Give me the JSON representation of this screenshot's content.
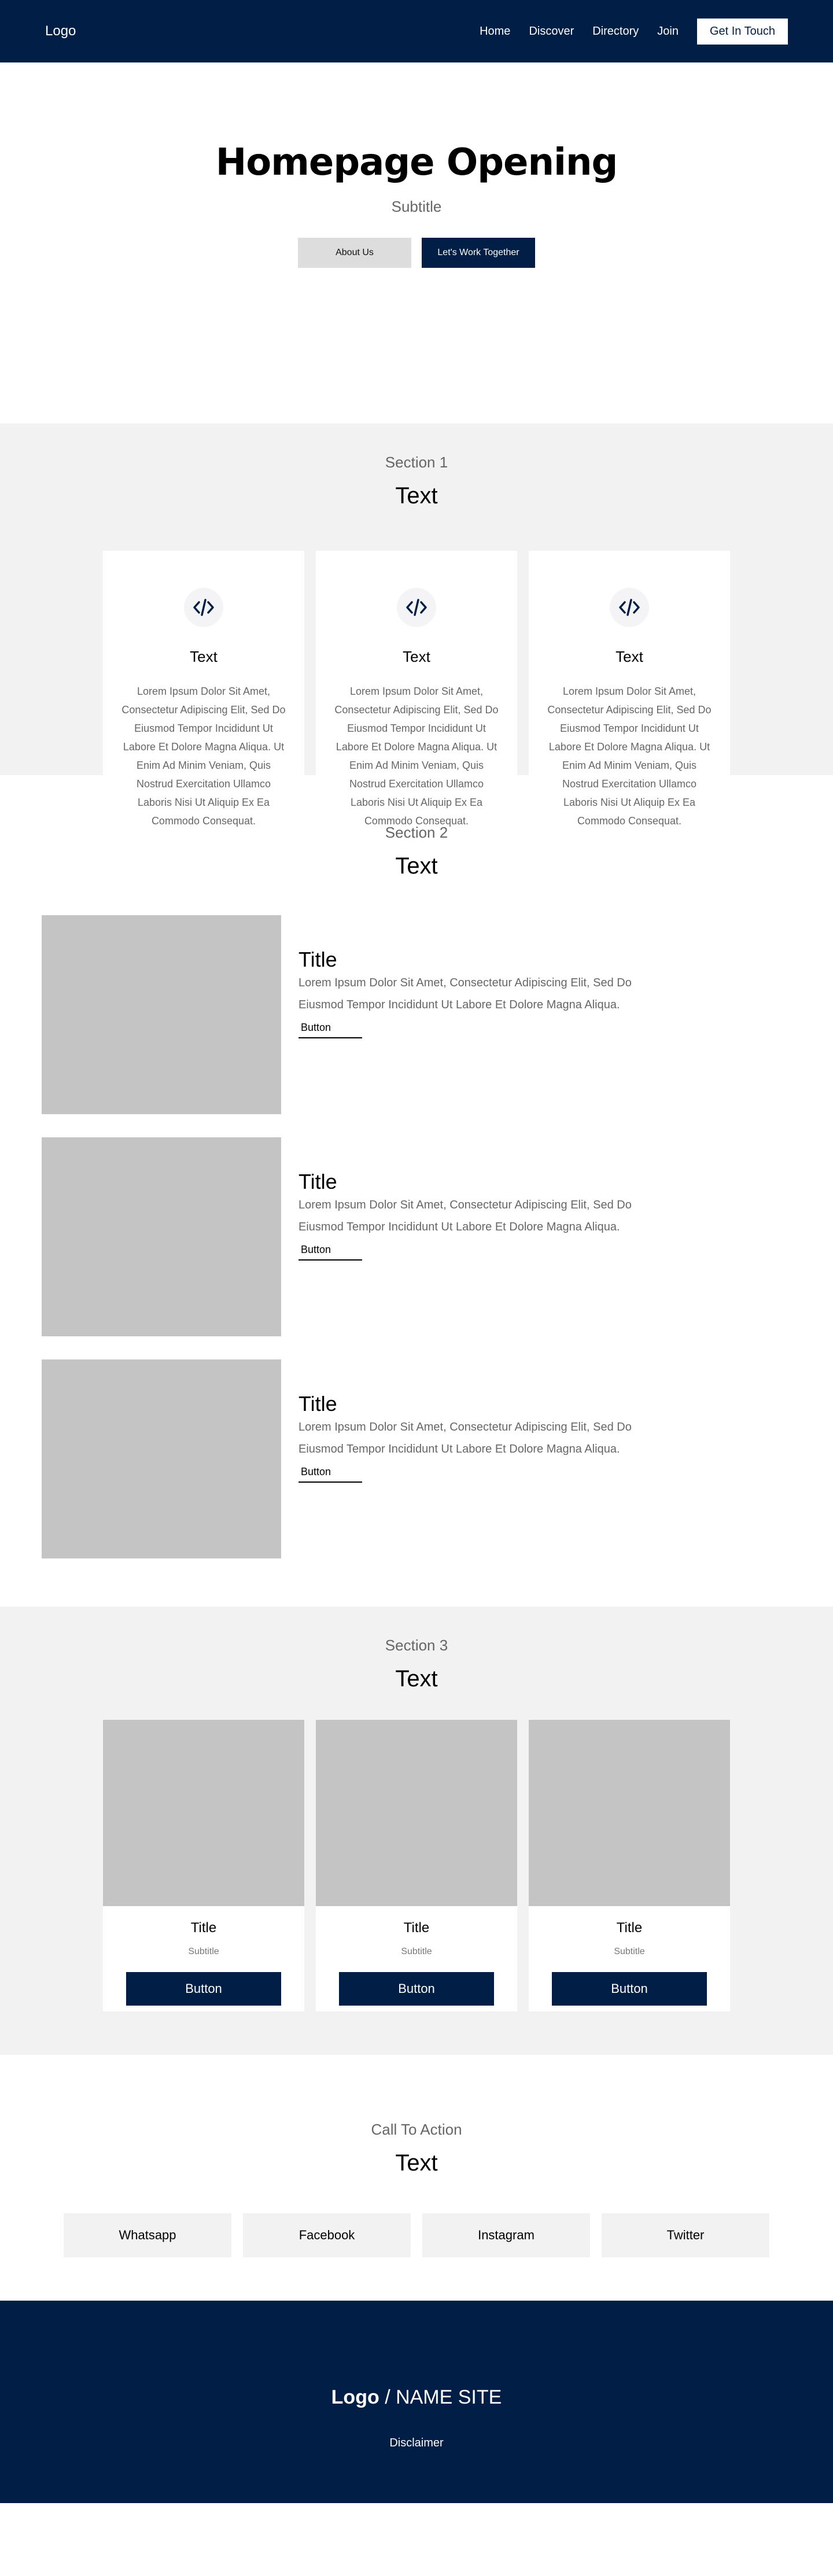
{
  "header": {
    "logo": "Logo",
    "nav": [
      "Home",
      "Discover",
      "Directory",
      "Join"
    ],
    "cta": "Get In Touch"
  },
  "hero": {
    "title": "Homepage Opening",
    "subtitle": "Subtitle",
    "btn_about": "About Us",
    "btn_work": "Let's Work Together"
  },
  "section1": {
    "label": "Section 1",
    "title": "Text",
    "icon": "code-icon",
    "cards": [
      {
        "title": "Text",
        "body": "Lorem Ipsum Dolor Sit Amet, Consectetur Adipiscing Elit, Sed Do Eiusmod Tempor Incididunt Ut Labore Et Dolore Magna Aliqua. Ut Enim Ad Minim Veniam, Quis Nostrud Exercitation Ullamco Laboris Nisi Ut Aliquip Ex Ea Commodo Consequat."
      },
      {
        "title": "Text",
        "body": "Lorem Ipsum Dolor Sit Amet, Consectetur Adipiscing Elit, Sed Do Eiusmod Tempor Incididunt Ut Labore Et Dolore Magna Aliqua. Ut Enim Ad Minim Veniam, Quis Nostrud Exercitation Ullamco Laboris Nisi Ut Aliquip Ex Ea Commodo Consequat."
      },
      {
        "title": "Text",
        "body": "Lorem Ipsum Dolor Sit Amet, Consectetur Adipiscing Elit, Sed Do Eiusmod Tempor Incididunt Ut Labore Et Dolore Magna Aliqua. Ut Enim Ad Minim Veniam, Quis Nostrud Exercitation Ullamco Laboris Nisi Ut Aliquip Ex Ea Commodo Consequat."
      }
    ]
  },
  "section2": {
    "label": "Section 2",
    "title": "Text",
    "rows": [
      {
        "title": "Title",
        "body": "Lorem Ipsum Dolor Sit Amet, Consectetur Adipiscing Elit, Sed Do Eiusmod Tempor Incididunt Ut Labore Et Dolore Magna Aliqua.",
        "button": "Button"
      },
      {
        "title": "Title",
        "body": "Lorem Ipsum Dolor Sit Amet, Consectetur Adipiscing Elit, Sed Do Eiusmod Tempor Incididunt Ut Labore Et Dolore Magna Aliqua.",
        "button": "Button"
      },
      {
        "title": "Title",
        "body": "Lorem Ipsum Dolor Sit Amet, Consectetur Adipiscing Elit, Sed Do Eiusmod Tempor Incididunt Ut Labore Et Dolore Magna Aliqua.",
        "button": "Button"
      }
    ]
  },
  "section3": {
    "label": "Section 3",
    "title": "Text",
    "cards": [
      {
        "title": "Title",
        "subtitle": "Subtitle",
        "button": "Button"
      },
      {
        "title": "Title",
        "subtitle": "Subtitle",
        "button": "Button"
      },
      {
        "title": "Title",
        "subtitle": "Subtitle",
        "button": "Button"
      }
    ]
  },
  "cta": {
    "label": "Call To Action",
    "title": "Text",
    "socials": [
      "Whatsapp",
      "Facebook",
      "Instagram",
      "Twitter"
    ]
  },
  "footer": {
    "logo": "Logo",
    "site": "/ NAME SITE",
    "disclaimer": "Disclaimer"
  },
  "colors": {
    "primary": "#011f46",
    "section_bg": "#f2f2f2",
    "placeholder": "#c4c4c4"
  }
}
